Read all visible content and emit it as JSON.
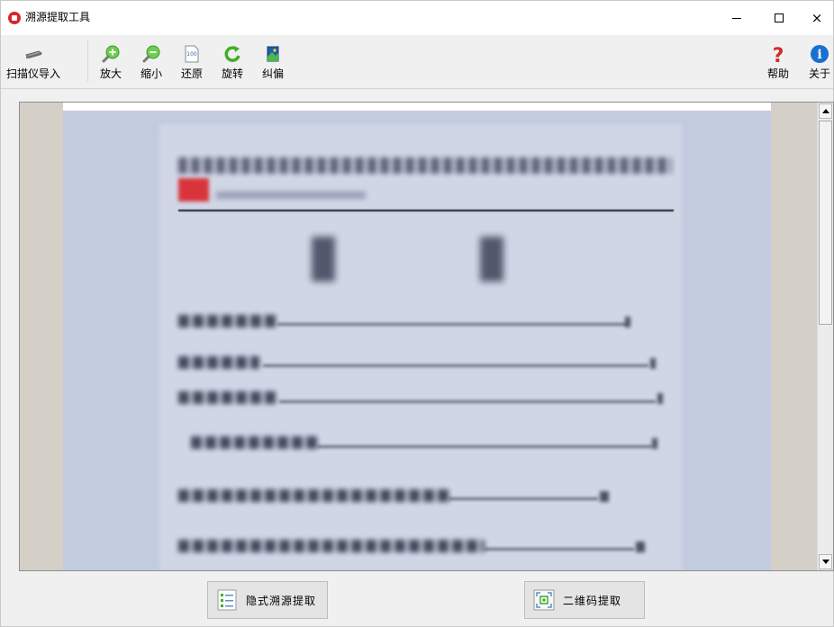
{
  "window": {
    "title": "溯源提取工具",
    "controls": {
      "minimize": "minimize-icon",
      "maximize": "maximize-icon",
      "close": "×"
    }
  },
  "toolbar": {
    "scanner_import": {
      "label": "扫描仪导入",
      "icon": "scanner-icon"
    },
    "zoom_in": {
      "label": "放大",
      "icon": "zoom-in-icon"
    },
    "zoom_out": {
      "label": "缩小",
      "icon": "zoom-out-icon"
    },
    "restore": {
      "label": "还原",
      "icon": "actual-size-icon",
      "icon_text": "100"
    },
    "rotate": {
      "label": "旋转",
      "icon": "rotate-icon"
    },
    "deskew": {
      "label": "纠偏",
      "icon": "deskew-icon"
    },
    "help": {
      "label": "帮助",
      "icon": "help-icon",
      "glyph": "?"
    },
    "about": {
      "label": "关于",
      "icon": "info-icon",
      "glyph": "i"
    }
  },
  "viewer": {
    "content": "blurred scanned document page"
  },
  "actions": {
    "hidden_trace_extract": {
      "label": "隐式溯源提取",
      "icon": "list-document-icon"
    },
    "qr_extract": {
      "label": "二维码提取",
      "icon": "qr-scan-icon"
    }
  },
  "colors": {
    "accent_green": "#3fae2a",
    "help_red": "#d12a2a",
    "info_blue": "#1a6fd1",
    "logo_red": "#d9252c"
  }
}
